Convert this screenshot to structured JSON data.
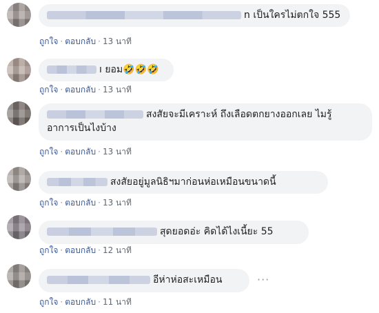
{
  "comments": [
    {
      "text": "n เป็นใครไม่ตกใจ 555",
      "like": "ถูกใจ",
      "reply": "ตอบกลับ",
      "time": "13 นาที"
    },
    {
      "text": "ı ยอม🤣🤣🤣",
      "like": "ถูกใจ",
      "reply": "ตอบกลับ",
      "time": "13 นาที"
    },
    {
      "text_line1": "สงสัยจะมีเคราะห์ ถึงเลือดตกยางออกเลย ไมรู้",
      "text_line2": "อาการเป็นไงบ้าง",
      "like": "ถูกใจ",
      "reply": "ตอบกลับ",
      "time": "13 นาที"
    },
    {
      "text": "สงสัยอยู่มูลนิธิฯมาก่อนห่อเหมือนขนาดนี้",
      "like": "ถูกใจ",
      "reply": "ตอบกลับ",
      "time": "13 นาที"
    },
    {
      "text": "สุดยอดอ่ะ คิดได้ไงเนี้ยะ 55",
      "like": "ถูกใจ",
      "reply": "ตอบกลับ",
      "time": "12 นาที"
    },
    {
      "text": "อีห่าห่อสะเหมือน",
      "like": "ถูกใจ",
      "reply": "ตอบกลับ",
      "time": "11 นาที",
      "more": "···"
    }
  ],
  "colors": {
    "bubble": "#f2f3f5",
    "link": "#385898",
    "meta": "#606770"
  }
}
